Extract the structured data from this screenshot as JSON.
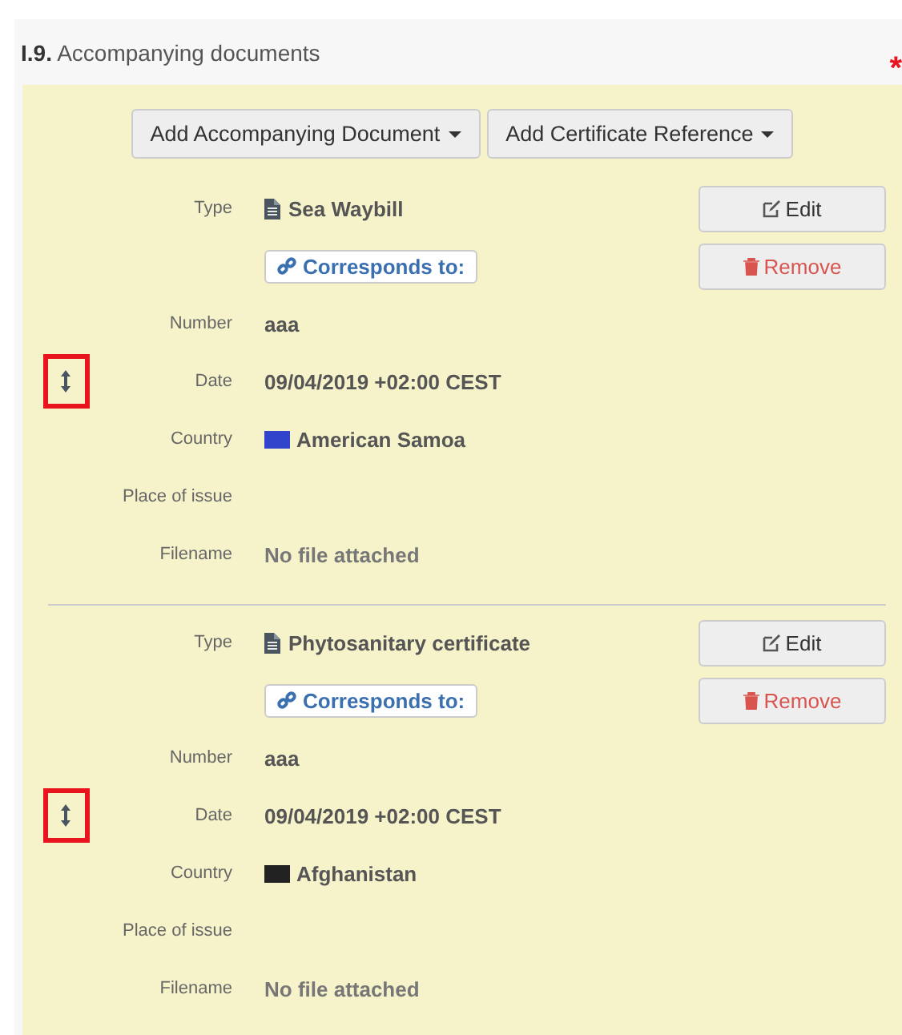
{
  "section": {
    "number": "I.9.",
    "title": "Accompanying documents",
    "required_mark": "*"
  },
  "actions": [
    {
      "label": "Add Accompanying Document"
    },
    {
      "label": "Add Certificate Reference"
    }
  ],
  "documents": [
    {
      "type_label": "Type",
      "type": "Sea Waybill",
      "corresponds": "Corresponds to:",
      "edit": "Edit",
      "remove": "Remove",
      "fields": [
        {
          "kind": "text",
          "label": "Number",
          "value": "aaa"
        },
        {
          "kind": "text",
          "label": "Date",
          "value": "09/04/2019 +02:00 CEST"
        },
        {
          "kind": "country",
          "label": "Country",
          "value": "American Samoa",
          "color": "#3344cc"
        },
        {
          "kind": "empty",
          "label": "Place of issue"
        },
        {
          "kind": "muted",
          "label": "Filename",
          "value": "No file attached"
        }
      ]
    },
    {
      "type_label": "Type",
      "type": "Phytosanitary certificate",
      "corresponds": "Corresponds to:",
      "edit": "Edit",
      "remove": "Remove",
      "fields": [
        {
          "kind": "text",
          "label": "Number",
          "value": "aaa"
        },
        {
          "kind": "text",
          "label": "Date",
          "value": "09/04/2019 +02:00 CEST"
        },
        {
          "kind": "country",
          "label": "Country",
          "value": "Afghanistan",
          "color": "#222222"
        },
        {
          "kind": "empty",
          "label": "Place of issue"
        },
        {
          "kind": "muted",
          "label": "Filename",
          "value": "No file attached"
        }
      ]
    }
  ]
}
